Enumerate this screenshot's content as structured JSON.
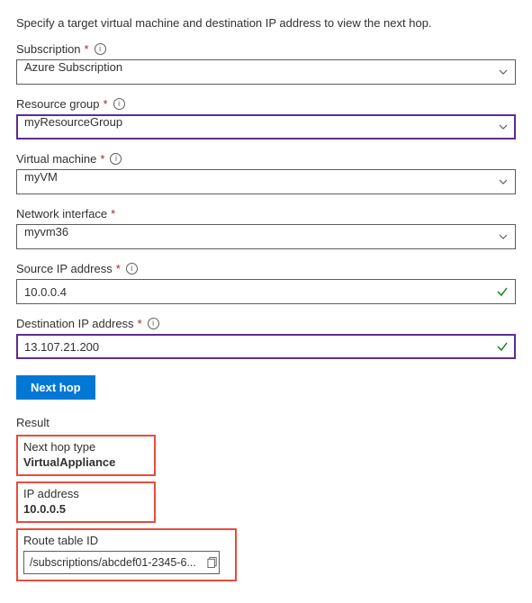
{
  "intro": "Specify a target virtual machine and destination IP address to view the next hop.",
  "fields": {
    "subscription": {
      "label": "Subscription",
      "required": true,
      "info": true,
      "value": "Azure Subscription",
      "kind": "select",
      "focused": false
    },
    "resourceGroup": {
      "label": "Resource group",
      "required": true,
      "info": true,
      "value": "myResourceGroup",
      "kind": "select",
      "focused": true
    },
    "vm": {
      "label": "Virtual machine",
      "required": true,
      "info": true,
      "value": "myVM",
      "kind": "select",
      "focused": false
    },
    "nic": {
      "label": "Network interface",
      "required": true,
      "info": false,
      "value": "myvm36",
      "kind": "select",
      "focused": false
    },
    "sourceIp": {
      "label": "Source IP address",
      "required": true,
      "info": true,
      "value": "10.0.0.4",
      "kind": "text",
      "valid": true,
      "focused": false
    },
    "destIp": {
      "label": "Destination IP address",
      "required": true,
      "info": true,
      "value": "13.107.21.200",
      "kind": "text",
      "valid": true,
      "focused": true
    }
  },
  "button": {
    "label": "Next hop"
  },
  "result": {
    "heading": "Result",
    "nextHopType": {
      "label": "Next hop type",
      "value": "VirtualAppliance"
    },
    "ipAddress": {
      "label": "IP address",
      "value": "10.0.0.5"
    },
    "routeTableId": {
      "label": "Route table ID",
      "value": "/subscriptions/abcdef01-2345-6..."
    }
  },
  "colors": {
    "accent": "#0078d4",
    "highlight": "#e74c3c",
    "focus": "#5c2d91",
    "valid": "#107c10"
  }
}
